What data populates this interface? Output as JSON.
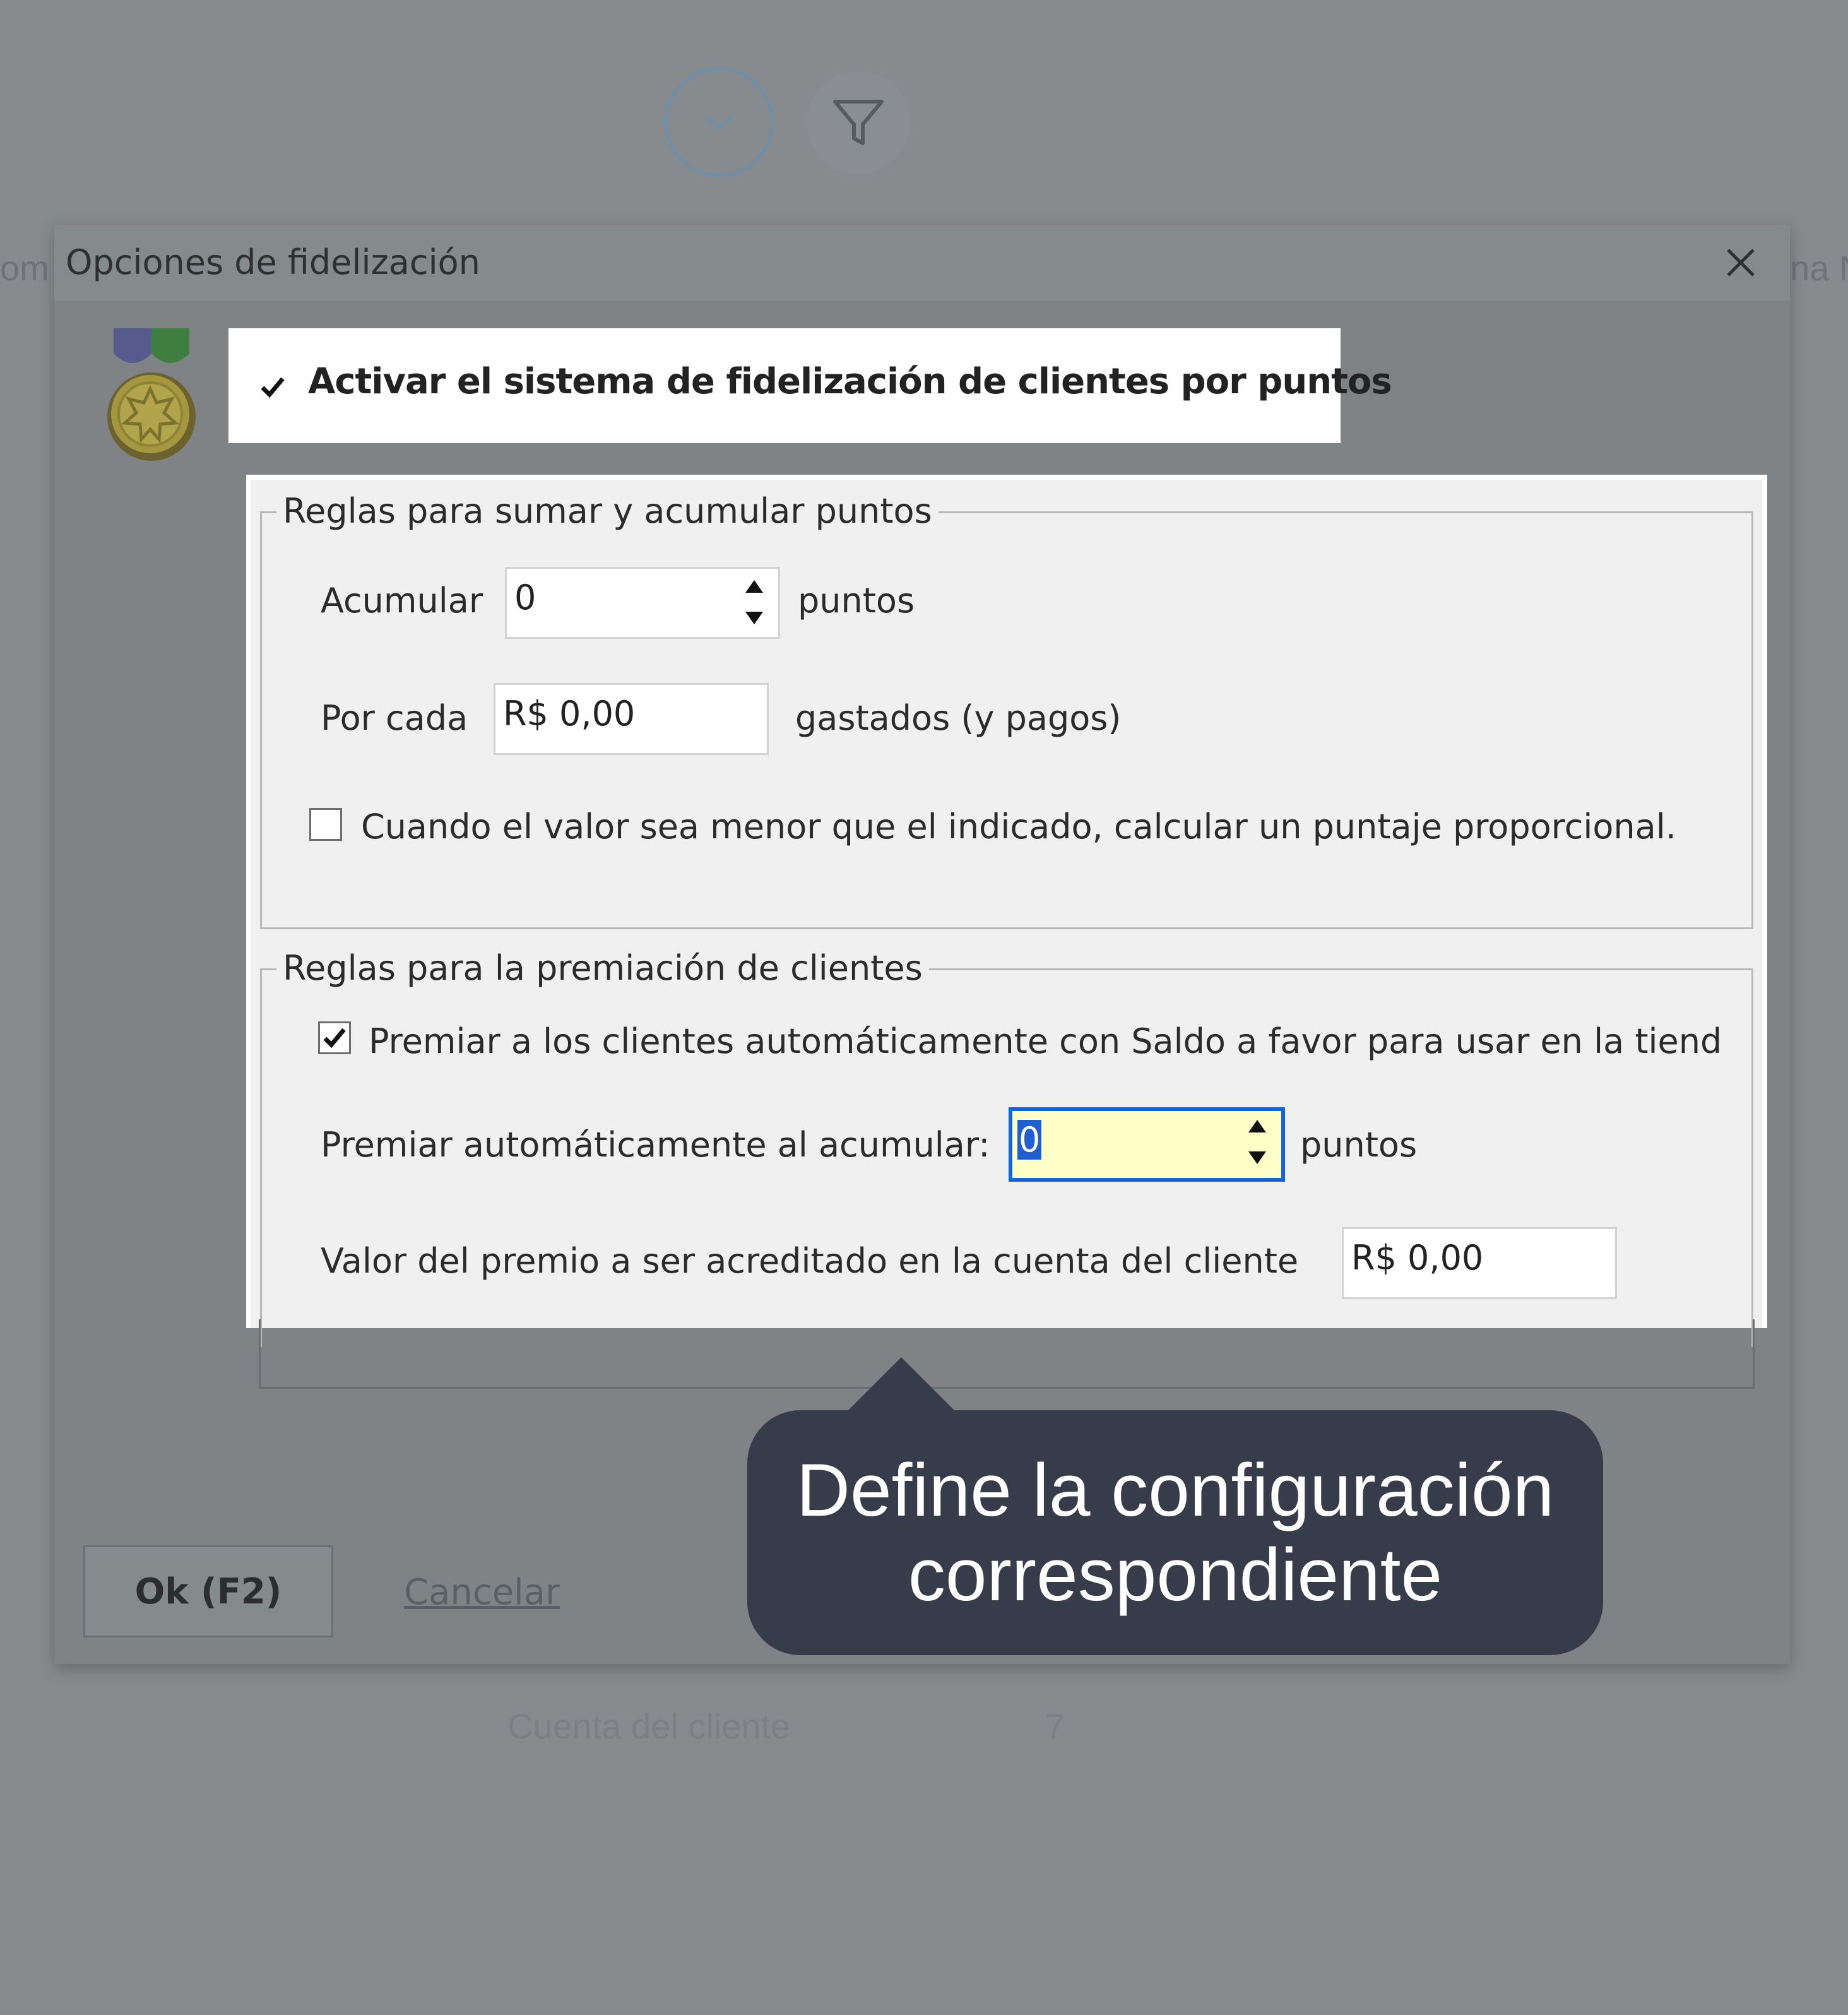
{
  "background": {
    "left_cut_text": "om",
    "right_cut_text": "na N",
    "footer_label": "Cuenta del cliente",
    "footer_value": "7"
  },
  "dialog": {
    "title": "Opciones de fidelización",
    "close_icon": "close-icon"
  },
  "loyalty": {
    "enable_label": "Activar el sistema de fidelización de clientes por puntos",
    "enable_checked": true
  },
  "accumulate": {
    "legend": "Reglas para sumar y acumular puntos",
    "acumular_label": "Acumular",
    "acumular_value": "0",
    "acumular_unit": "puntos",
    "por_cada_label": "Por cada",
    "por_cada_value": "R$ 0,00",
    "por_cada_unit": "gastados (y pagos)",
    "proportional_label": "Cuando el valor sea menor que el indicado, calcular un puntaje proporcional.",
    "proportional_checked": false
  },
  "reward": {
    "legend": "Reglas para la premiación de clientes",
    "auto_label": "Premiar a los clientes automáticamente con Saldo a favor para usar en la tiend",
    "auto_checked": true,
    "threshold_label": "Premiar automáticamente al acumular:",
    "threshold_value": "0",
    "threshold_unit": "puntos",
    "value_label": "Valor del premio a ser acreditado en la cuenta del cliente",
    "value_value": "R$ 0,00"
  },
  "buttons": {
    "ok_label": "Ok (F2)",
    "cancel_label": "Cancelar"
  },
  "tooltip": {
    "line1": "Define la configuración",
    "line2": "correspondiente"
  }
}
